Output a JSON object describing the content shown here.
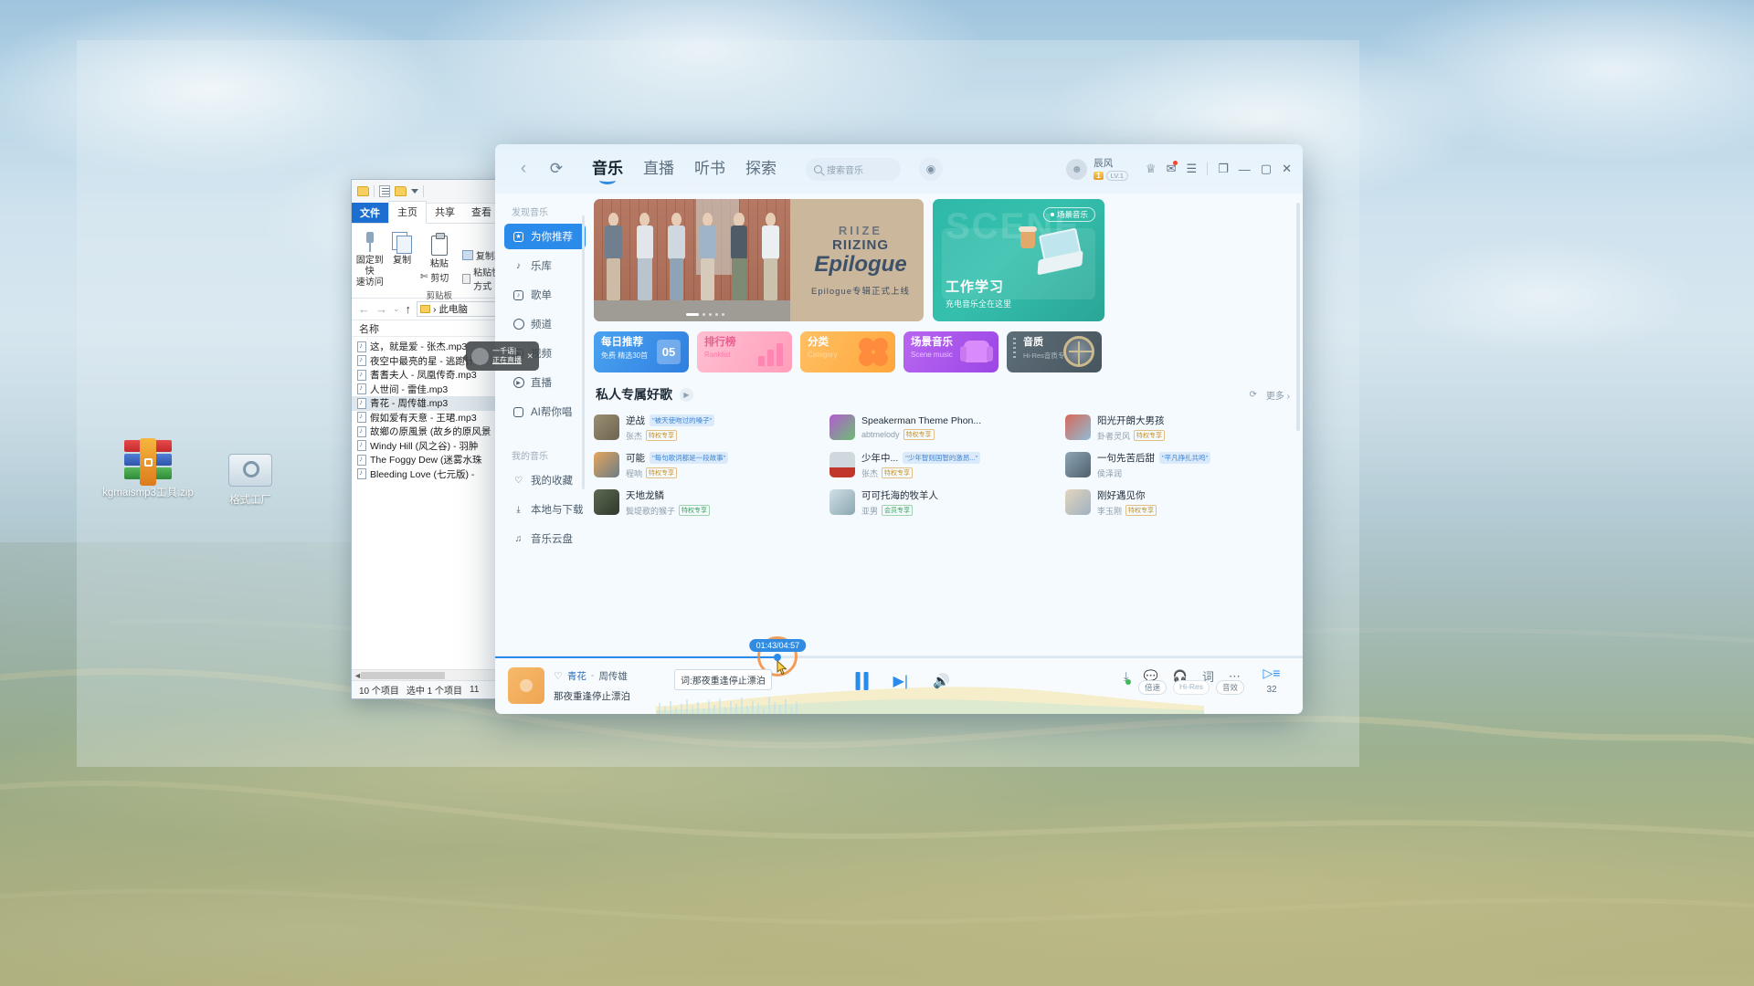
{
  "desktop": {
    "icons": [
      {
        "name": "kgmaismp3工具.zip",
        "type": "winrar-archive"
      },
      {
        "name": "格式工厂",
        "type": "format-factory"
      }
    ]
  },
  "explorer": {
    "quick_access": [
      "folder-icon",
      "properties-icon",
      "new-folder-icon",
      "customize-caret-icon"
    ],
    "tabs": [
      {
        "label": "文件",
        "active": false,
        "kind": "file-menu"
      },
      {
        "label": "主页",
        "active": true
      },
      {
        "label": "共享",
        "active": false
      },
      {
        "label": "查看",
        "active": false
      }
    ],
    "ribbon": {
      "pin": "固定到快\n速访问",
      "pin_line1": "固定到快",
      "pin_line2": "速访问",
      "copy": "复制",
      "paste": "粘贴",
      "cut": "剪切",
      "copy_path": "复制路径",
      "paste_shortcut": "粘贴快捷方式",
      "group_label": "剪贴板"
    },
    "path": "此电脑",
    "column_header": "名称",
    "files": [
      {
        "name": "这，就是爱 - 张杰.mp3",
        "selected": false
      },
      {
        "name": "夜空中最亮的星 - 逃跑计划",
        "selected": false
      },
      {
        "name": "耆耆夫人 - 凤凰传奇.mp3",
        "selected": false
      },
      {
        "name": "人世间 - 雷佳.mp3",
        "selected": false
      },
      {
        "name": "青花 - 周传雄.mp3",
        "selected": true
      },
      {
        "name": "假如爱有天意 - 王珺.mp3",
        "selected": false
      },
      {
        "name": "故鄉の原風景 (故乡的原风景",
        "selected": false
      },
      {
        "name": "Windy Hill (风之谷) - 羽肿",
        "selected": false
      },
      {
        "name": "The Foggy Dew (迷雾水珠",
        "selected": false
      },
      {
        "name": "Bleeding Love (七元版) - ",
        "selected": false
      }
    ],
    "status": {
      "count": "10 个项目",
      "selected": "选中 1 个项目",
      "size": "11"
    }
  },
  "music_app": {
    "header": {
      "back_icon": "chevron-left-icon",
      "refresh_icon": "refresh-icon",
      "tabs": [
        {
          "label": "音乐",
          "active": true
        },
        {
          "label": "直播",
          "active": false
        },
        {
          "label": "听书",
          "active": false
        },
        {
          "label": "探索",
          "active": false
        }
      ],
      "search_placeholder": "搜索音乐",
      "mic_icon": "microphone-icon",
      "user": {
        "name": "辰风",
        "level_badge": "1",
        "level_text": "LV.1"
      },
      "actions": [
        "shirt-icon",
        "mail-icon",
        "menu-icon",
        "mini-mode-icon",
        "minimize-icon",
        "maximize-icon",
        "close-icon"
      ]
    },
    "sidebar": {
      "group1_title": "发现音乐",
      "group1": [
        {
          "label": "为你推荐",
          "icon": "star-box-icon",
          "active": true
        },
        {
          "label": "乐库",
          "icon": "note-icon",
          "active": false
        },
        {
          "label": "歌单",
          "icon": "playlist-icon",
          "active": false
        },
        {
          "label": "频道",
          "icon": "channel-icon",
          "active": false
        },
        {
          "label": "视频",
          "icon": "video-icon",
          "active": false
        },
        {
          "label": "直播",
          "icon": "live-icon",
          "active": false
        },
        {
          "label": "AI帮你唱",
          "icon": "ai-sing-icon",
          "active": false
        }
      ],
      "group2_title": "我的音乐",
      "group2": [
        {
          "label": "我的收藏",
          "icon": "heart-icon"
        },
        {
          "label": "本地与下载",
          "icon": "download-icon"
        },
        {
          "label": "音乐云盘",
          "icon": "cloud-note-icon"
        }
      ]
    },
    "live_tooltip": {
      "line1": "一千语|",
      "line2": "正在直播",
      "close_icon": "close-icon"
    },
    "banners": {
      "main": {
        "logo": "RIIZE",
        "title1": "RIIZING",
        "title2": "Epilogue",
        "subtitle": "Epilogue专辑正式上线"
      },
      "side": {
        "watermark": "SCENE",
        "pill": "场景音乐",
        "title": "工作学习",
        "subtitle": "充电音乐全在这里"
      }
    },
    "quick_cards": [
      {
        "title": "每日推荐",
        "sub": "免费 精选30首",
        "num": "05"
      },
      {
        "title": "排行榜",
        "sub": "Ranklist"
      },
      {
        "title": "分类",
        "sub": "Category"
      },
      {
        "title": "场景音乐",
        "sub": "Scene music"
      },
      {
        "title": "音质",
        "sub": "Hi-Res音质专区"
      }
    ],
    "section": {
      "title": "私人专属好歌",
      "play_icon": "play-icon",
      "refresh_icon": "refresh-icon",
      "more": "更多 ›"
    },
    "songs": [
      {
        "name": "逆战",
        "tag": "\"被天使吻过的嗓子\"",
        "artist": "张杰",
        "badge": "特权专享",
        "cover": "#8a7f6a"
      },
      {
        "name": "Speakerman Theme Phon...",
        "tag": "",
        "artist": "abtmelody",
        "badge": "特权专享",
        "cover": "#a24fbe"
      },
      {
        "name": "阳光开朗大男孩",
        "tag": "",
        "artist": "卦者灵风",
        "badge": "特权专享",
        "cover": "#c9594b"
      },
      {
        "name": "可能",
        "tag": "\"每句歌词都是一段故事\"",
        "artist": "程响",
        "badge": "特权专享",
        "cover": "#c98b52"
      },
      {
        "name": "少年中...",
        "tag": "\"少年智则国智的激昂...\"",
        "artist": "张杰",
        "badge": "特权专享",
        "cover": "#b5443a"
      },
      {
        "name": "一句先苦后甜",
        "tag": "\"平凡挣扎共鸣\"",
        "artist": "侯泽润",
        "badge": "",
        "cover": "#7d97a8"
      },
      {
        "name": "天地龙鳞",
        "tag": "",
        "artist": "鬓堤歌的猴子",
        "badge": "特权专享",
        "cover": "#4f5a46"
      },
      {
        "name": "可可托海的牧羊人",
        "tag": "",
        "artist": "亚男",
        "badge": "会员专享",
        "cover": "#9fb4bd"
      },
      {
        "name": "刚好遇见你",
        "tag": "",
        "artist": "李玉刚",
        "badge": "特权专享",
        "cover": "#c8b89a"
      }
    ],
    "player": {
      "liked_icon": "heart-icon",
      "song": "青花",
      "separator": "-",
      "artist": "周传雄",
      "lyric": "那夜重逢停止漂泊",
      "time_tooltip": "01:43/04:57",
      "lyric_tooltip": "词:那夜重逢停止漂泊",
      "progress_percent": 35,
      "controls": [
        "pause-icon",
        "next-icon",
        "volume-icon"
      ],
      "right_icons": [
        "download-icon",
        "comment-icon",
        "headphones-icon",
        "lyrics-icon",
        "more-icon"
      ],
      "chips": [
        "倍速",
        "Hi-Res",
        "音效"
      ],
      "playlist_icon": "playlist-icon",
      "playlist_count": "32"
    }
  }
}
